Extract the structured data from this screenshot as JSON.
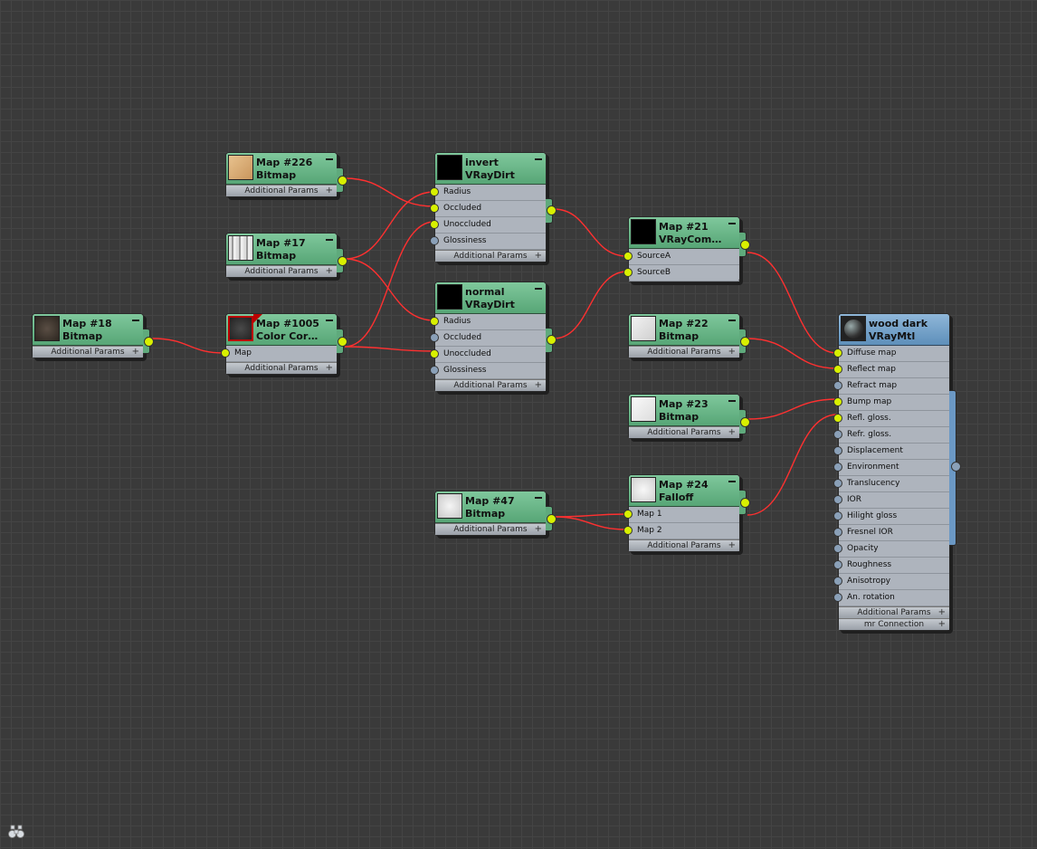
{
  "nodes": {
    "map18": {
      "title": "Map #18",
      "type": "Bitmap",
      "footer": "Additional Params"
    },
    "map226": {
      "title": "Map #226",
      "type": "Bitmap",
      "footer": "Additional Params"
    },
    "map17": {
      "title": "Map #17",
      "type": "Bitmap",
      "footer": "Additional Params"
    },
    "map1005": {
      "title": "Map #1005",
      "type": "Color  Cor…",
      "input": "Map",
      "footer": "Additional Params"
    },
    "invert": {
      "title": "invert",
      "type": "VRayDirt",
      "slots": [
        "Radius",
        "Occluded",
        "Unoccluded",
        "Glossiness"
      ],
      "footer": "Additional Params"
    },
    "normal": {
      "title": "normal",
      "type": "VRayDirt",
      "slots": [
        "Radius",
        "Occluded",
        "Unoccluded",
        "Glossiness"
      ],
      "footer": "Additional Params"
    },
    "map21": {
      "title": "Map #21",
      "type": "VRayCom…",
      "slots": [
        "SourceA",
        "SourceB"
      ]
    },
    "map22": {
      "title": "Map #22",
      "type": "Bitmap",
      "footer": "Additional Params"
    },
    "map23": {
      "title": "Map #23",
      "type": "Bitmap",
      "footer": "Additional Params"
    },
    "map47": {
      "title": "Map #47",
      "type": "Bitmap",
      "footer": "Additional Params"
    },
    "map24": {
      "title": "Map #24",
      "type": "Falloff",
      "slots": [
        "Map 1",
        "Map 2"
      ],
      "footer": "Additional Params"
    },
    "wood": {
      "title": "wood dark",
      "type": "VRayMtl",
      "slots": [
        "Diffuse map",
        "Reflect map",
        "Refract map",
        "Bump map",
        "Refl. gloss.",
        "Refr. gloss.",
        "Displacement",
        "Environment",
        "Translucency",
        "IOR",
        "Hilight gloss",
        "Fresnel IOR",
        "Opacity",
        "Roughness",
        "Anisotropy",
        "An. rotation"
      ],
      "footer": "Additional Params",
      "footer2": "mr Connection"
    }
  },
  "colors": {
    "wire": "#ff3030",
    "socket_on": "#d8f000",
    "socket_off": "#8aa0b8",
    "node_header": "#5fae7e",
    "material_header": "#6e9cc6"
  },
  "icons": {
    "search": "binoculars-icon"
  }
}
